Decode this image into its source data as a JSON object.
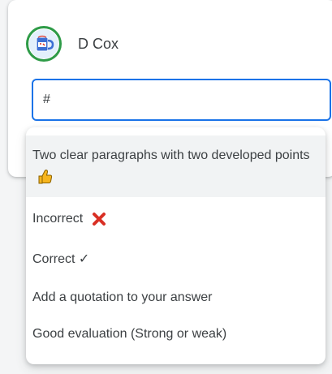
{
  "user": {
    "name": "D Cox",
    "avatar_icon": "mug-icon"
  },
  "comment_input": {
    "value": "#"
  },
  "suggestions": [
    {
      "text": "Two clear paragraphs with two developed points",
      "icon": "thumbs-up-icon",
      "highlighted": true
    },
    {
      "text": "Incorrect",
      "icon": "cross-mark-icon",
      "highlighted": false
    },
    {
      "text": "Correct ✓",
      "highlighted": false
    },
    {
      "text": "Add a quotation to your answer",
      "highlighted": false
    },
    {
      "text": "Good evaluation (Strong or weak)",
      "highlighted": false
    }
  ],
  "colors": {
    "accent": "#1a73e8",
    "avatar_ring": "#2e9b47",
    "cross": "#d93025",
    "thumb": "#f6b51e",
    "highlight": "#f1f3f4"
  }
}
